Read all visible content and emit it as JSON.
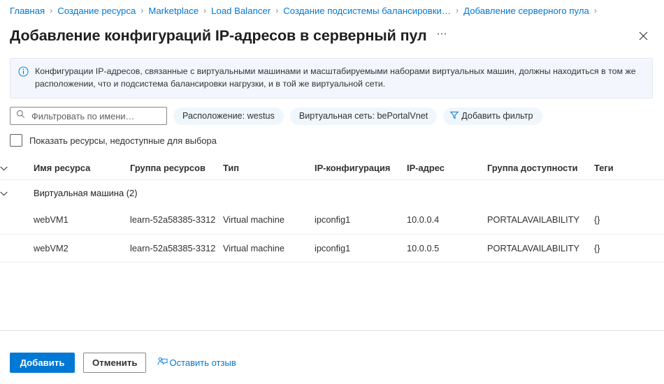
{
  "breadcrumb": {
    "separator": "›",
    "items": [
      {
        "label": "Главная"
      },
      {
        "label": "Создание ресурса"
      },
      {
        "label": "Marketplace"
      },
      {
        "label": "Load Balancer"
      },
      {
        "label": "Создание подсистемы балансировки…"
      },
      {
        "label": "Добавление серверного пула"
      }
    ]
  },
  "header": {
    "title": "Добавление конфигураций IP-адресов в серверный пул",
    "more_label": "⋯",
    "more_icon": "ellipsis-icon",
    "close_icon": "close-icon"
  },
  "info_banner": {
    "icon": "info-circle-icon",
    "text": "Конфигурации IP-адресов, связанные с виртуальными машинами и масштабируемыми наборами виртуальных машин, должны находиться в том же расположении, что и подсистема балансировки нагрузки, и в той же виртуальной сети.",
    "background": "#f3f7fd",
    "accent": "#0078d4"
  },
  "filters": {
    "search": {
      "icon": "search-icon",
      "value": "",
      "placeholder": "Фильтровать по имени…"
    },
    "pills": [
      {
        "label": "Расположение: westus"
      },
      {
        "label": "Виртуальная сеть: bePortalVnet"
      }
    ],
    "add_filter": {
      "icon": "filter-icon",
      "label": "Добавить фильтр"
    },
    "show_unavailable": {
      "label": "Показать ресурсы, недоступные для выбора",
      "checked": false
    }
  },
  "table": {
    "expand_icon": "chevron-down-icon",
    "columns": [
      {
        "label": ""
      },
      {
        "label": "Имя ресурса"
      },
      {
        "label": "Группа ресурсов"
      },
      {
        "label": "Тип"
      },
      {
        "label": "IP-конфигурация"
      },
      {
        "label": "IP-адрес"
      },
      {
        "label": "Группа доступности"
      },
      {
        "label": "Теги"
      }
    ],
    "group": {
      "label": "Виртуальная машина (2)",
      "expanded": true
    },
    "rows": [
      {
        "checked": true,
        "name": "webVM1",
        "resource_group": "learn-52a58385-3312",
        "type": "Virtual machine",
        "ip_config": "ipconfig1",
        "ip_address": "10.0.0.4",
        "availability_set": "PORTALAVAILABILITY",
        "tags": "{}"
      },
      {
        "checked": true,
        "name": "webVM2",
        "resource_group": "learn-52a58385-3312",
        "type": "Virtual machine",
        "ip_config": "ipconfig1",
        "ip_address": "10.0.0.5",
        "availability_set": "PORTALAVAILABILITY",
        "tags": "{}"
      }
    ]
  },
  "footer": {
    "primary_button": "Добавить",
    "secondary_button": "Отменить",
    "feedback_label": "Оставить отзыв",
    "feedback_icon": "feedback-person-icon"
  },
  "colors": {
    "accent": "#0078d4",
    "link": "#0078d4",
    "text": "#323130",
    "pill_bg": "#eff6fc",
    "divider": "#edebe9"
  }
}
